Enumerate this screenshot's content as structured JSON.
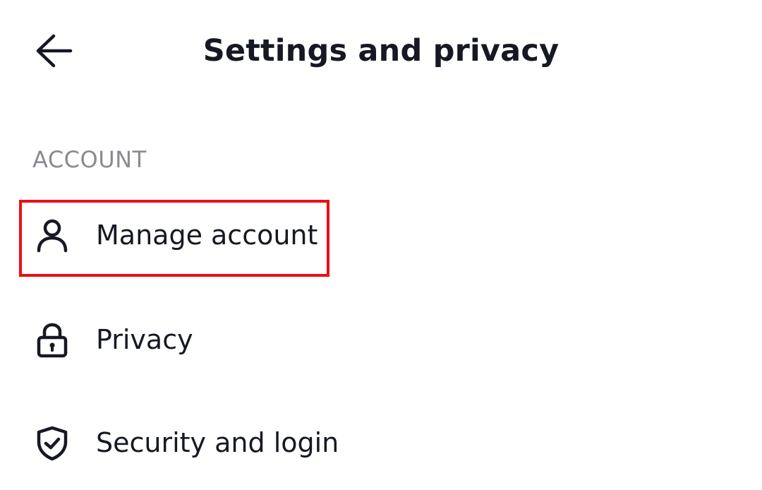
{
  "header": {
    "title": "Settings and privacy",
    "back_icon": "arrow-left-icon"
  },
  "sections": [
    {
      "title": "ACCOUNT",
      "items": [
        {
          "label": "Manage account",
          "icon": "person-icon"
        },
        {
          "label": "Privacy",
          "icon": "lock-icon"
        },
        {
          "label": "Security and login",
          "icon": "shield-check-icon"
        }
      ]
    }
  ],
  "colors": {
    "text": "#161823",
    "section_header": "#8a8b91",
    "highlight": "#ee0d12",
    "background": "#ffffff"
  }
}
